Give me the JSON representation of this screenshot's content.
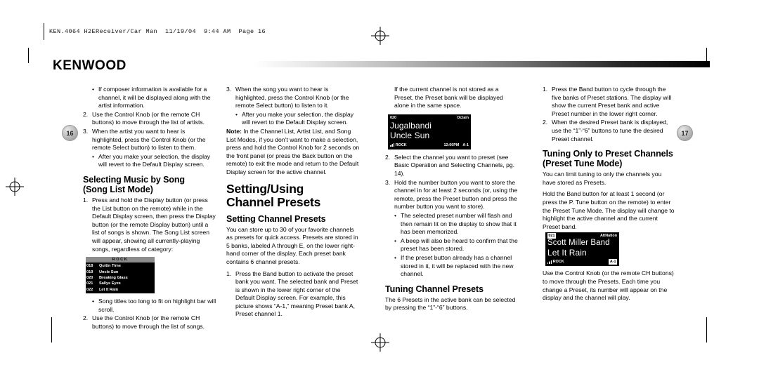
{
  "slug": "KEN.4064 H2EReceiver/Car Man  11/19/04  9:44 AM  Page 16",
  "brand": "KENWOOD",
  "page_left": "16",
  "page_right": "17",
  "col1": {
    "b1": {
      "marker": "•",
      "text": "If composer information is available for a channel, it will be displayed along with the artist information."
    },
    "i2": {
      "marker": "2.",
      "text": "Use the Control Knob (or the remote CH buttons) to move through the list of artists."
    },
    "i3": {
      "marker": "3.",
      "text": "When the artist you want to hear is highlighted, press the Control Knob (or the remote Select button) to listen to them."
    },
    "b3": {
      "marker": "•",
      "text": "After you make your selection, the display will revert to the Default Display screen."
    },
    "heading_line1": "Selecting Music by Song",
    "heading_line2": "(Song List Mode)",
    "i4": {
      "marker": "1.",
      "text": "Press and hold the Display button (or press the List button on the remote) while in the Default Display screen, then press the Display button (or the remote Display button) until a list of songs is shown. The Song List screen will appear, showing all currently-playing songs, regardless of category:"
    },
    "songlist": {
      "header": "ROCK",
      "rows": [
        {
          "num": "018",
          "title": "Quittn Time"
        },
        {
          "num": "019",
          "title": "Uncle Sun"
        },
        {
          "num": "020",
          "title": "Breaking Glass"
        },
        {
          "num": "021",
          "title": "Sallys Eyes"
        },
        {
          "num": "022",
          "title": "Let It Rain"
        }
      ]
    },
    "b5": {
      "marker": "•",
      "text": "Song titles too long to fit on highlight bar will scroll."
    },
    "i5": {
      "marker": "2.",
      "text": "Use the Control Knob (or the remote CH buttons) to move through the list of songs."
    }
  },
  "col2": {
    "i1": {
      "marker": "3.",
      "text": "When the song you want to hear is highlighted, press the Control Knob (or the remote Select button) to listen to it."
    },
    "b1": {
      "marker": "•",
      "text": "After you make your selection, the display will revert to the Default Display screen."
    },
    "note_label": "Note:",
    "note_text": " In the Channel List, Artist List, and Song List Modes, if you don’t want to make a selection, press and hold the Control Knob for 2 seconds on the front panel (or press the Back button on the remote) to exit the mode and return to the Default Display screen for the active channel.",
    "heading_line1": "Setting/Using",
    "heading_line2": "Channel Presets",
    "subheading": "Setting Channel Presets",
    "intro": "You can store up to 30 of your favorite channels as presets for quick access. Presets are stored in 5 banks, labeled A through E, on the lower right-hand corner of the display. Each preset bank contains 6 channel presets.",
    "i2": {
      "marker": "1.",
      "text": "Press the Band button to activate the preset bank you want. The selected bank and Preset is shown in the lower right corner of the Default Display screen. For example, this picture shows “A-1,” meaning Preset bank A, Preset channel 1."
    }
  },
  "col3": {
    "intro": "If the current channel is not stored as a Preset, the Preset bank will be displayed alone in the same space.",
    "display": {
      "channel_number": "020",
      "category": "Octain",
      "line1": "Jugalbandi",
      "line2": "Uncle Sun",
      "band": "ROCK",
      "time": "12:00PM",
      "preset": "A-1"
    },
    "i2": {
      "marker": "2.",
      "text": "Select the channel you want to preset (see Basic Operation and Selecting Channels, pg. 14)."
    },
    "i3": {
      "marker": "3.",
      "text": "Hold the number button you want to store the channel in for at least 2 seconds (or, using the remote, press the Preset button and press the number button you want to store)."
    },
    "b1": {
      "marker": "•",
      "text": "The selected preset number will flash and then remain lit on the display to show that it has been memorized."
    },
    "b2": {
      "marker": "•",
      "text": "A beep will also be heard to confirm that the preset has been stored."
    },
    "b3": {
      "marker": "•",
      "text": "If the preset button already has a channel stored in it, it will be replaced with the new channel."
    },
    "subheading": "Tuning Channel Presets",
    "outro": "The 6 Presets in the active bank can be selected by pressing the “1”-“6” buttons."
  },
  "col4": {
    "i1": {
      "marker": "1.",
      "text": "Press the Band button to cycle through the five banks of Preset stations. The display will show the current Preset bank and active Preset number in the lower right corner."
    },
    "i2": {
      "marker": "2.",
      "text": "When the desired Preset bank is displayed, use the “1”-“6” buttons to tune the desired Preset channel."
    },
    "heading_line1": "Tuning Only to Preset Channels",
    "heading_line2": "(Preset Tune Mode)",
    "p1": "You can limit tuning to only the channels you have stored as Presets.",
    "p2": "Hold the Band button for at least 1 second (or press the P. Tune button on the remote) to enter the Preset Tune Mode. The display will change to highlight the active channel and the current Preset band.",
    "display": {
      "channel_number": "021",
      "category": "AltNation",
      "line1": "Scott Miller Band",
      "line2": "Let It Rain",
      "band": "ROCK",
      "preset": "A-1"
    },
    "p3": "Use the Control Knob (or the remote CH buttons) to move through the Presets. Each time you change a Preset, its number will appear on the display and the channel will play."
  }
}
